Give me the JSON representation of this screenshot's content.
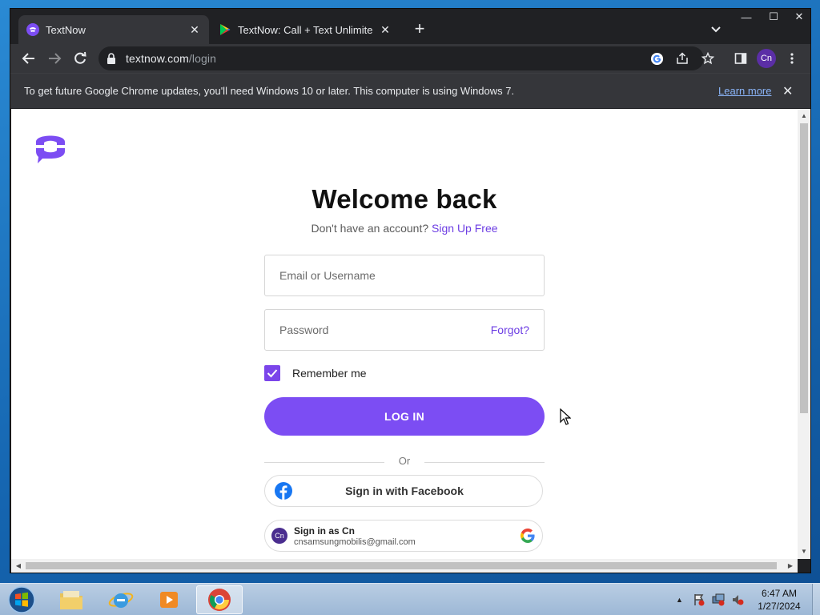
{
  "browser": {
    "tabs": [
      {
        "title": "TextNow",
        "active": true
      },
      {
        "title": "TextNow: Call + Text Unlimited - A",
        "active": false
      }
    ],
    "window_controls": {
      "minimize": "—",
      "maximize": "☐",
      "close": "✕"
    },
    "url_host": "textnow.com",
    "url_path": "/login",
    "profile_initials": "Cn",
    "infobar": {
      "message": "To get future Google Chrome updates, you'll need Windows 10 or later. This computer is using Windows 7.",
      "link": "Learn more"
    }
  },
  "page": {
    "heading": "Welcome back",
    "signup_prompt": "Don't have an account?",
    "signup_link": "Sign Up Free",
    "email_placeholder": "Email or Username",
    "password_placeholder": "Password",
    "forgot_link": "Forgot?",
    "remember_label": "Remember me",
    "remember_checked": true,
    "login_button": "LOG IN",
    "or_divider": "Or",
    "facebook_button": "Sign in with Facebook",
    "google_account": {
      "initials": "Cn",
      "name": "Sign in as Cn",
      "email": "cnsamsungmobilis@gmail.com"
    }
  },
  "taskbar": {
    "time": "6:47 AM",
    "date": "1/27/2024"
  },
  "colors": {
    "accent": "#7c4df3",
    "link": "#6d3ee3",
    "chrome_dark": "#202124",
    "chrome_toolbar": "#35363a"
  }
}
